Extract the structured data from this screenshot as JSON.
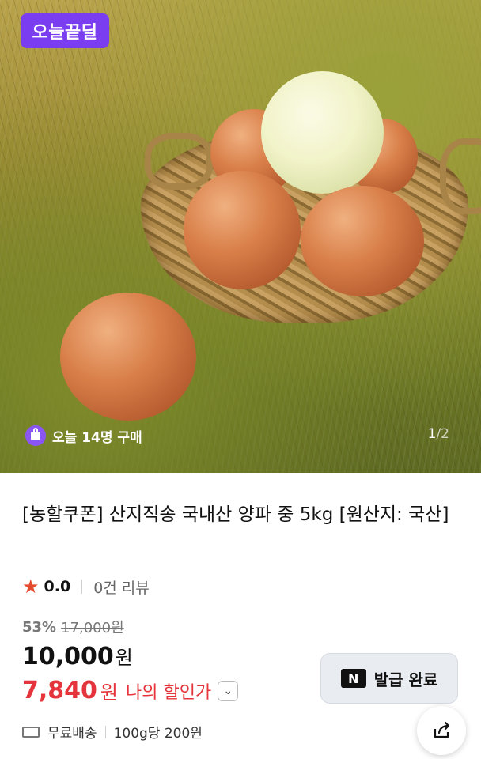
{
  "hero": {
    "deal_badge": "오늘끝딜",
    "buyers_today": "오늘 14명 구매",
    "image_index": "1",
    "image_sep": "/",
    "image_total": "2"
  },
  "product": {
    "title": "[농할쿠폰] 산지직송 국내산 양파 중 5kg [원산지: 국산]",
    "rating": "0.0",
    "reviews": "0건 리뷰",
    "discount_pct": "53%",
    "original_price": "17,000원",
    "price_number": "10,000",
    "price_unit": "원",
    "my_price_number": "7,840",
    "my_price_unit": "원",
    "my_price_label": "나의 할인가"
  },
  "coupon": {
    "label": "발급 완료",
    "icon": "naver-n-icon"
  },
  "shipping": {
    "label": "무료배송",
    "unit_price": "100g당 200원"
  },
  "colors": {
    "accent_purple": "#7a3df0",
    "discount_red": "#e6343c",
    "star": "#e64a2e"
  }
}
